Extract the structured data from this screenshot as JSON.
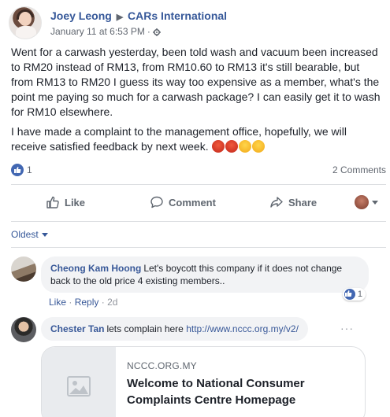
{
  "post": {
    "author": "Joey Leong",
    "target": "CARs International",
    "timestamp": "January 11 at 6:53 PM",
    "separator": "·",
    "paragraph1": "Went for a carwash yesterday, been told wash and vacuum been increased to RM20 instead of RM13, from RM10.60 to RM13 it's still bearable, but from RM13 to RM20 I guess its way too expensive as a member, what's the point me paying so much for a carwash package? I can easily get it to wash for RM10 elsewhere.",
    "paragraph2": "I have made a complaint to the management office, hopefully, we will receive satisfied feedback by next week."
  },
  "stats": {
    "reaction_count": "1",
    "comments_label": "2 Comments"
  },
  "actions": {
    "like": "Like",
    "comment": "Comment",
    "share": "Share"
  },
  "sort": {
    "label": "Oldest"
  },
  "comments": [
    {
      "author": "Cheong Kam Hoong",
      "text": "Let's boycott this company if it does not change back to the old price 4 existing members..",
      "like": "Like",
      "reply": "Reply",
      "time": "2d",
      "reaction_count": "1"
    },
    {
      "author": "Chester Tan",
      "text": "lets complain here",
      "link": "http://www.nccc.org.my/v2/"
    }
  ],
  "link_preview": {
    "domain": "NCCC.ORG.MY",
    "title": "Welcome to National Consumer Complaints Centre Homepage"
  },
  "colors": {
    "link_blue": "#365899",
    "like_blue": "#4267b2",
    "text": "#1d2129",
    "muted": "#616770",
    "bubble_bg": "#f2f3f5"
  },
  "icons": {
    "emoji_1": "pouting-face",
    "emoji_2": "pouting-face",
    "emoji_3": "angry-face",
    "emoji_4": "face-with-steam"
  }
}
